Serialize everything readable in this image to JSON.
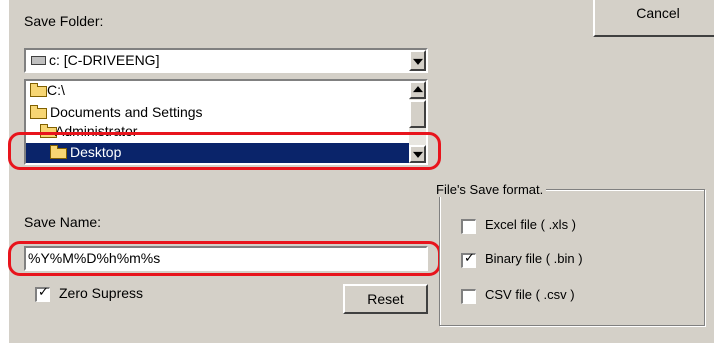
{
  "cancel_label": "Cancel",
  "save_folder": {
    "label": "Save Folder:",
    "drive_value": "c: [C-DRIVEENG]",
    "folders": [
      {
        "label": "C:\\",
        "selected": false
      },
      {
        "label": "Documents and Settings",
        "selected": false
      },
      {
        "label": "Administrator",
        "selected": false
      },
      {
        "label": "Desktop",
        "selected": true
      }
    ]
  },
  "save_name": {
    "label": "Save Name:",
    "value": "%Y%M%D%h%m%s"
  },
  "zero_supress": {
    "label": "Zero Supress",
    "checked": true
  },
  "reset_label": "Reset",
  "file_format": {
    "title": "File's Save format.",
    "options": [
      {
        "label": "Excel file  ( .xls )",
        "checked": false
      },
      {
        "label": "Binary file ( .bin )",
        "checked": true
      },
      {
        "label": "CSV file ( .csv )",
        "checked": false
      }
    ]
  },
  "colors": {
    "highlight": "#e8141c",
    "selection": "#0a246a",
    "face": "#d4d0c8"
  }
}
